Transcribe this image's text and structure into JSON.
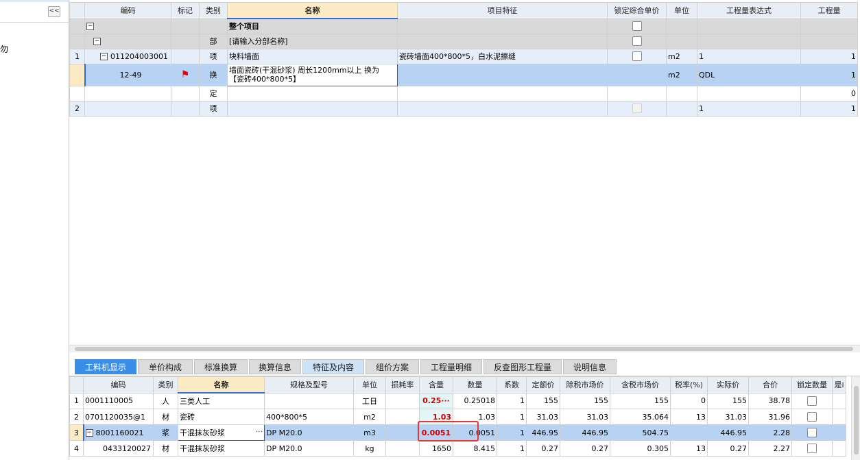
{
  "sidebar": {
    "collapse_glyph": "<<",
    "fragment_text": "勿"
  },
  "top_table": {
    "headers": [
      "编码",
      "标记",
      "类别",
      "名称",
      "项目特征",
      "锁定综合单价",
      "单位",
      "工程量表达式",
      "工程量"
    ],
    "rows": [
      {
        "num": "",
        "code": "",
        "mark": "",
        "type": "",
        "name": "整个项目",
        "feature": "",
        "unit": "",
        "expr": "",
        "qty": ""
      },
      {
        "num": "",
        "code": "",
        "mark": "",
        "type": "部",
        "name": "[请输入分部名称]",
        "feature": "",
        "unit": "",
        "expr": "",
        "qty": ""
      },
      {
        "num": "1",
        "code": "011204003001",
        "mark": "",
        "type": "项",
        "name": "块料墙面",
        "feature": "瓷砖墙面400*800*5，白水泥擦缝",
        "unit": "m2",
        "expr": "1",
        "qty": "1"
      },
      {
        "num": "",
        "code": "12-49",
        "mark": "flag",
        "type": "换",
        "name_line1": "墙面瓷砖(干混砂浆) 周长1200mm以上  换为",
        "name_line2": "【瓷砖400*800*5】",
        "feature": "",
        "unit": "m2",
        "expr": "QDL",
        "qty": "1"
      },
      {
        "num": "",
        "code": "",
        "mark": "",
        "type": "定",
        "name": "",
        "feature": "",
        "unit": "",
        "expr": "",
        "qty": "0"
      },
      {
        "num": "2",
        "code": "",
        "mark": "",
        "type": "项",
        "name": "",
        "feature": "",
        "unit": "",
        "expr": "1",
        "qty": "1"
      }
    ]
  },
  "tabs": [
    "工料机显示",
    "单价构成",
    "标准换算",
    "换算信息",
    "特征及内容",
    "组价方案",
    "工程量明细",
    "反查图形工程量",
    "说明信息"
  ],
  "bottom_table": {
    "headers": [
      "编码",
      "类别",
      "名称",
      "规格及型号",
      "单位",
      "损耗率",
      "含量",
      "数量",
      "系数",
      "定额价",
      "除税市场价",
      "含税市场价",
      "税率(%)",
      "实际价",
      "合价",
      "锁定数量",
      "是i"
    ],
    "rows": [
      {
        "num": "1",
        "code": "0001110005",
        "type": "人",
        "name": "三类人工",
        "spec": "",
        "unit": "工日",
        "loss": "",
        "content": "0.25···",
        "qty": "0.25018",
        "coef": "1",
        "quota": "155",
        "exmkt": "155",
        "inmkt": "155",
        "tax": "0",
        "actual": "155",
        "total": "38.78"
      },
      {
        "num": "2",
        "code": "070112003​5@1",
        "type": "材",
        "name": "瓷砖",
        "spec": "400*800*5",
        "unit": "m2",
        "loss": "",
        "content": "1.03",
        "qty": "1.03",
        "coef": "1",
        "quota": "31.03",
        "exmkt": "31.03",
        "inmkt": "35.064",
        "tax": "13",
        "actual": "31.03",
        "total": "31.96"
      },
      {
        "num": "3",
        "code": "8001160021",
        "type": "浆",
        "name": "干混抹灰砂浆",
        "spec": "DP M20.0",
        "unit": "m3",
        "loss": "",
        "content": "0.0051",
        "qty": "0.0051",
        "coef": "1",
        "quota": "446.95",
        "exmkt": "446.95",
        "inmkt": "504.75",
        "tax": "",
        "actual": "446.95",
        "total": "2.28"
      },
      {
        "num": "4",
        "code": "0433120027",
        "type": "材",
        "name": "干混抹灰砂浆",
        "spec": "DP M20.0",
        "unit": "kg",
        "loss": "",
        "content": "1650",
        "qty": "8.415",
        "coef": "1",
        "quota": "0.27",
        "exmkt": "0.27",
        "inmkt": "0.305",
        "tax": "13",
        "actual": "0.27",
        "total": "2.27"
      }
    ]
  },
  "colors": {
    "accent": "#3a8ee6",
    "selection": "#b7d2f3",
    "header": "#e9eef5",
    "highlight_red": "#e53935"
  }
}
